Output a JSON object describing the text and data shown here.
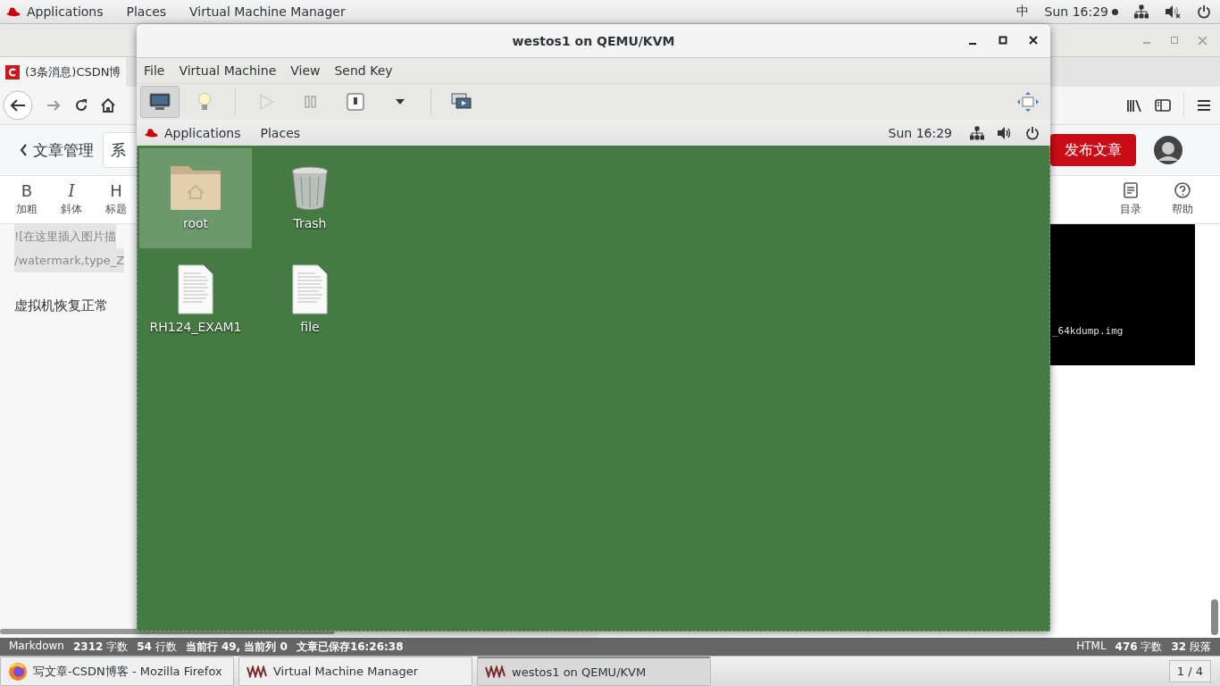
{
  "top_bar": {
    "menus": [
      "Applications",
      "Places",
      "Virtual Machine Manager"
    ],
    "input_method": "中",
    "clock": "Sun 16:29"
  },
  "firefox": {
    "tab_title": "(3条消息)CSDN博",
    "editor": {
      "back_label": "文章管理",
      "title_value": "系",
      "publish_button": "发布文章",
      "toolbar": [
        {
          "glyph": "B",
          "label": "加粗",
          "kind": "bold"
        },
        {
          "glyph": "I",
          "label": "斜体",
          "kind": "italic"
        },
        {
          "glyph": "H",
          "label": "标题",
          "kind": "heading"
        }
      ],
      "toolbar_right": [
        {
          "label": "目录",
          "kind": "toc"
        },
        {
          "label": "帮助",
          "kind": "help"
        }
      ],
      "lines": [
        {
          "text": "![在这里插入图片描",
          "kind": "highlight"
        },
        {
          "text": "/watermark,type_Z",
          "kind": "highlight"
        },
        {
          "text": "虚拟机恢复正常",
          "kind": "plain"
        }
      ],
      "preview_image_text": "_64kdump.img"
    },
    "status_bar": {
      "left": [
        "Markdown",
        "**2312** 字数",
        "**54** 行数",
        "**当前行 49, 当前列 0**",
        "**文章已保存16:26:38**"
      ],
      "right": [
        "HTML",
        "**476** 字数",
        "**32** 段落"
      ]
    }
  },
  "vm_window": {
    "title": "westos1 on QEMU/KVM",
    "menus": [
      "File",
      "Virtual Machine",
      "View",
      "Send Key"
    ],
    "toolbar": [
      {
        "kind": "console",
        "selected": true,
        "disabled": false
      },
      {
        "kind": "details",
        "selected": false,
        "disabled": false
      },
      {
        "kind": "run",
        "selected": false,
        "disabled": true
      },
      {
        "kind": "pause",
        "selected": false,
        "disabled": false
      },
      {
        "kind": "shutdown",
        "selected": false,
        "disabled": false
      },
      {
        "kind": "dropdown",
        "selected": false,
        "disabled": false
      },
      {
        "kind": "snapshots",
        "selected": false,
        "disabled": false
      }
    ],
    "guest": {
      "menus": [
        "Applications",
        "Places"
      ],
      "clock": "Sun 16:29",
      "icons": [
        {
          "label": "root",
          "kind": "folder",
          "selected": true
        },
        {
          "label": "Trash",
          "kind": "trash",
          "selected": false
        },
        {
          "label": "RH124_EXAM1",
          "kind": "document",
          "selected": false
        },
        {
          "label": "file",
          "kind": "document",
          "selected": false
        }
      ]
    }
  },
  "taskbar": {
    "items": [
      {
        "label": "写文章-CSDN博客 - Mozilla Firefox",
        "kind": "firefox",
        "selected": false
      },
      {
        "label": "Virtual Machine Manager",
        "kind": "vmm",
        "selected": false
      },
      {
        "label": "westos1 on QEMU/KVM",
        "kind": "vmm",
        "selected": true
      }
    ],
    "workspace": "1 / 4"
  }
}
